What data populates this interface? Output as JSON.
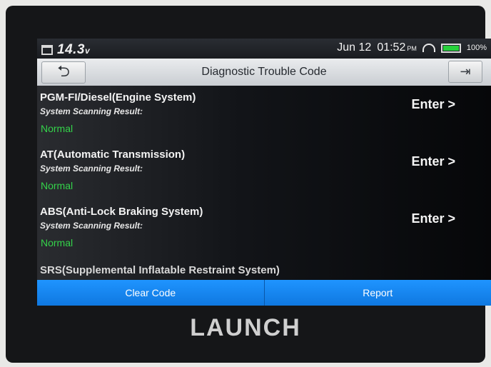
{
  "statusbar": {
    "voltage": "14.3",
    "voltage_unit": "v",
    "date": "Jun 12",
    "time": "01:52",
    "ampm": "PM",
    "battery_percent": "100%",
    "battery_level": 1.0,
    "icons": [
      "calendar-icon",
      "wifi-icon",
      "battery-icon"
    ]
  },
  "titlebar": {
    "title": "Diagnostic Trouble Code",
    "back_icon": "back-arrow-icon",
    "exit_icon": "exit-icon"
  },
  "systems": [
    {
      "name": "PGM-FI/Diesel(Engine System)",
      "scan_label": "System Scanning Result:",
      "result": "Normal",
      "enter_label": "Enter >"
    },
    {
      "name": "AT(Automatic Transmission)",
      "scan_label": "System Scanning Result:",
      "result": "Normal",
      "enter_label": "Enter >"
    },
    {
      "name": "ABS(Anti-Lock Braking System)",
      "scan_label": "System Scanning Result:",
      "result": "Normal",
      "enter_label": "Enter >"
    }
  ],
  "partial_row": "SRS(Supplemental Inflatable Restraint System)",
  "actions": {
    "clear_code": "Clear Code",
    "report": "Report"
  },
  "brand": "LAUNCH",
  "colors": {
    "accent": "#1583f0",
    "normal_green": "#34d34a",
    "battery_green": "#27d13b"
  }
}
